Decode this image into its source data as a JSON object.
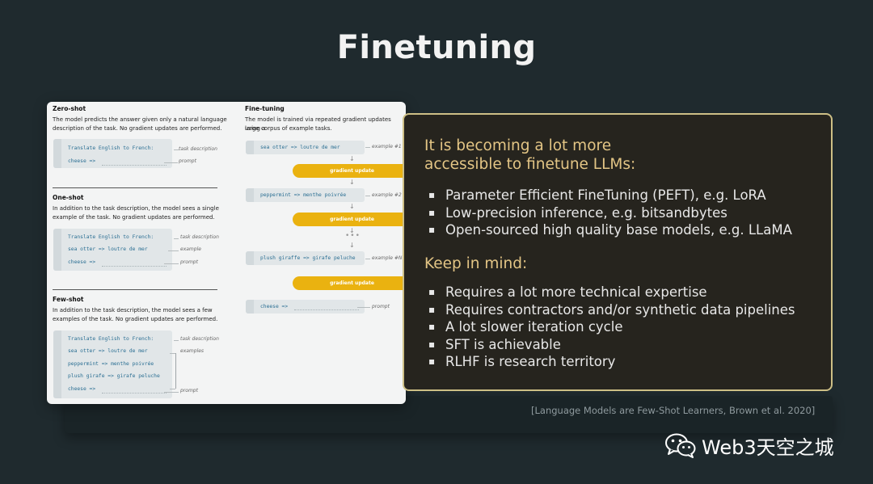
{
  "slide": {
    "title": "Finetuning",
    "citation": "[Language Models are Few-Shot Learners, Brown et al. 2020]",
    "watermark": "Web3天空之城"
  },
  "figure": {
    "zero_shot": {
      "title": "Zero-shot",
      "desc": [
        "The model predicts the answer given only a natural language",
        "description of the task. No gradient updates are performed."
      ],
      "lines": [
        "Translate English to French:",
        "cheese =>"
      ],
      "annotations": [
        "task description",
        "prompt"
      ]
    },
    "one_shot": {
      "title": "One-shot",
      "desc": [
        "In addition to the task description, the model sees a single",
        "example of the task. No gradient updates are performed."
      ],
      "lines": [
        "Translate English to French:",
        "sea otter => loutre de mer",
        "cheese =>"
      ],
      "annotations": [
        "task description",
        "example",
        "prompt"
      ]
    },
    "few_shot": {
      "title": "Few-shot",
      "desc": [
        "In addition to the task description, the model sees a few",
        "examples of the task. No gradient updates are performed."
      ],
      "lines": [
        "Translate English to French:",
        "sea otter => loutre de mer",
        "peppermint => menthe poivrée",
        "plush girafe => girafe peluche",
        "cheese =>"
      ],
      "annotations": [
        "task description",
        "examples",
        "prompt"
      ]
    },
    "fine_tuning": {
      "title": "Fine-tuning",
      "desc": [
        "The model is trained via repeated gradient updates using a",
        "large corpus of example tasks."
      ],
      "examples": [
        "sea otter => loutre de mer",
        "peppermint => menthe poivrée",
        "plush giraffe => girafe peluche"
      ],
      "example_labels": [
        "example #1",
        "example #2",
        "example #N"
      ],
      "gradient_label": "gradient update",
      "prompt_line": "cheese =>",
      "prompt_label": "prompt"
    }
  },
  "panel": {
    "heading1_line1": "It is becoming a lot more",
    "heading1_line2": "accessible to finetune LLMs:",
    "list1": [
      "Parameter Efficient FineTuning (PEFT), e.g. LoRA",
      "Low-precision inference, e.g. bitsandbytes",
      "Open-sourced high quality base models, e.g. LLaMA"
    ],
    "heading2": "Keep in mind:",
    "list2": [
      "Requires a lot more technical expertise",
      "Requires contractors and/or synthetic data pipelines",
      "A lot slower iteration cycle",
      "SFT is achievable",
      "RLHF is research territory"
    ],
    "bullet_char": "▪"
  },
  "colors": {
    "background": "#1f2a2e",
    "panel_border": "#cdbf86",
    "heading": "#e3c585",
    "gradient_pill": "#eab210",
    "code_text": "#2b6f93"
  }
}
